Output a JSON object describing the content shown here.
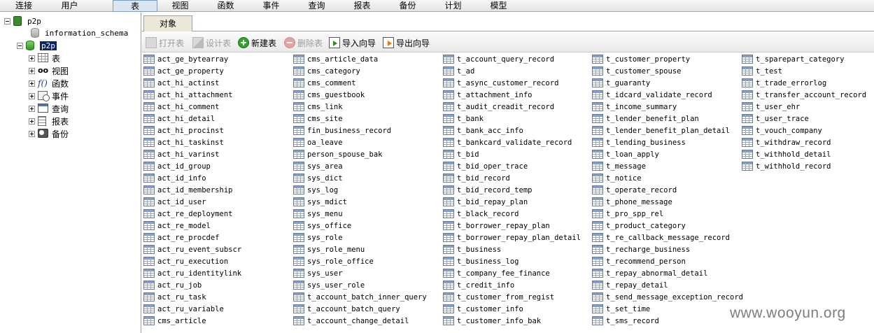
{
  "menubar": {
    "items": [
      {
        "label": "连接",
        "active": false
      },
      {
        "label": "用户",
        "active": false
      },
      {
        "label": "表",
        "active": true
      },
      {
        "label": "视图",
        "active": false
      },
      {
        "label": "函数",
        "active": false
      },
      {
        "label": "事件",
        "active": false
      },
      {
        "label": "查询",
        "active": false
      },
      {
        "label": "报表",
        "active": false
      },
      {
        "label": "备份",
        "active": false
      },
      {
        "label": "计划",
        "active": false
      },
      {
        "label": "模型",
        "active": false
      }
    ]
  },
  "tree": {
    "connection": "p2p",
    "databases": [
      "information_schema",
      "p2p"
    ],
    "selected_database": "p2p",
    "categories": [
      {
        "label": "表",
        "icon": "table-icon"
      },
      {
        "label": "视图",
        "icon": "view-glasses-icon"
      },
      {
        "label": "函数",
        "icon": "function-fx-icon"
      },
      {
        "label": "事件",
        "icon": "event-clock-icon"
      },
      {
        "label": "查询",
        "icon": "query-icon"
      },
      {
        "label": "报表",
        "icon": "report-icon"
      },
      {
        "label": "备份",
        "icon": "backup-icon"
      }
    ]
  },
  "tabs": {
    "objects": "对象"
  },
  "toolbar": {
    "open": "打开表",
    "design": "设计表",
    "new": "新建表",
    "delete": "删除表",
    "import": "导入向导",
    "export": "导出向导"
  },
  "tables": {
    "columns": [
      [
        "act_ge_bytearray",
        "act_ge_property",
        "act_hi_actinst",
        "act_hi_attachment",
        "act_hi_comment",
        "act_hi_detail",
        "act_hi_procinst",
        "act_hi_taskinst",
        "act_hi_varinst",
        "act_id_group",
        "act_id_info",
        "act_id_membership",
        "act_id_user",
        "act_re_deployment",
        "act_re_model",
        "act_re_procdef",
        "act_ru_event_subscr",
        "act_ru_execution",
        "act_ru_identitylink",
        "act_ru_job",
        "act_ru_task",
        "act_ru_variable",
        "cms_article"
      ],
      [
        "cms_article_data",
        "cms_category",
        "cms_comment",
        "cms_guestbook",
        "cms_link",
        "cms_site",
        "fin_business_record",
        "oa_leave",
        "person_spouse_bak",
        "sys_area",
        "sys_dict",
        "sys_log",
        "sys_mdict",
        "sys_menu",
        "sys_office",
        "sys_role",
        "sys_role_menu",
        "sys_role_office",
        "sys_user",
        "sys_user_role",
        "t_account_batch_inner_query",
        "t_account_batch_query",
        "t_account_change_detail"
      ],
      [
        "t_account_query_record",
        "t_ad",
        "t_async_customer_record",
        "t_attachment_info",
        "t_audit_creadit_record",
        "t_bank",
        "t_bank_acc_info",
        "t_bankcard_validate_record",
        "t_bid",
        "t_bid_oper_trace",
        "t_bid_record",
        "t_bid_record_temp",
        "t_bid_repay_plan",
        "t_black_record",
        "t_borrower_repay_plan",
        "t_borrower_repay_plan_detail",
        "t_business",
        "t_business_log",
        "t_company_fee_finance",
        "t_credit_info",
        "t_customer_from_regist",
        "t_customer_info",
        "t_customer_info_bak"
      ],
      [
        "t_customer_property",
        "t_customer_spouse",
        "t_guaranty",
        "t_idcard_validate_record",
        "t_income_summary",
        "t_lender_benefit_plan",
        "t_lender_benefit_plan_detail",
        "t_lending_business",
        "t_loan_apply",
        "t_message",
        "t_notice",
        "t_operate_record",
        "t_phone_message",
        "t_pro_spp_rel",
        "t_product_category",
        "t_re_callback_message_record",
        "t_recharge_business",
        "t_recommend_person",
        "t_repay_abnormal_detail",
        "t_repay_detail",
        "t_send_message_exception_record",
        "t_set_time",
        "t_sms_record"
      ],
      [
        "t_sparepart_category",
        "t_test",
        "t_trade_errorlog",
        "t_transfer_account_record",
        "t_user_ehr",
        "t_user_trace",
        "t_vouch_company",
        "t_withdraw_record",
        "t_withhold_detail",
        "t_withhold_record"
      ]
    ]
  },
  "watermark": "www.wooyun.org"
}
